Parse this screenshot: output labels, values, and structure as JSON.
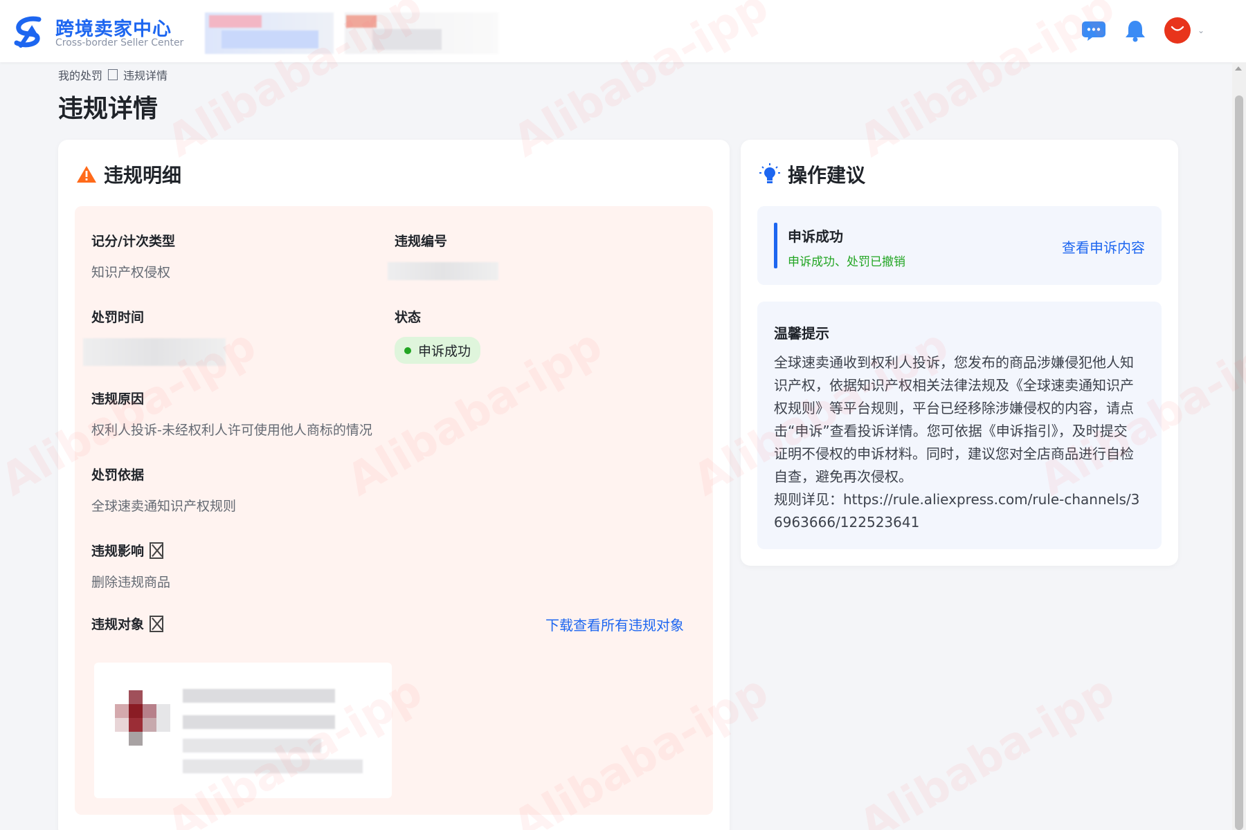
{
  "header": {
    "logo_title": "跨境卖家中心",
    "logo_subtitle": "Cross-border Seller Center",
    "icons": [
      "chat-icon",
      "bell-icon",
      "avatar"
    ],
    "avatar_text": "AliExpress"
  },
  "breadcrumb": {
    "parent": "我的处罚",
    "current": "违规详情"
  },
  "page_title": "违规详情",
  "violation_card": {
    "title": "违规明细",
    "fields": {
      "type_label": "记分/计次类型",
      "type_value": "知识产权侵权",
      "id_label": "违规编号",
      "time_label": "处罚时间",
      "status_label": "状态",
      "status_value": "申诉成功",
      "reason_label": "违规原因",
      "reason_value": "权利人投诉-未经权利人许可使用他人商标的情况",
      "basis_label": "处罚依据",
      "basis_value": "全球速卖通知识产权规则",
      "impact_label": "违规影响",
      "impact_value": "删除违规商品",
      "object_label": "违规对象",
      "download_link": "下载查看所有违规对象"
    }
  },
  "suggestion_card": {
    "title": "操作建议",
    "appeal": {
      "title": "申诉成功",
      "subtitle": "申诉成功、处罚已撤销",
      "link": "查看申诉内容"
    },
    "tips": {
      "title": "温馨提示",
      "body": "全球速卖通收到权利人投诉，您发布的商品涉嫌侵犯他人知识产权，依据知识产权相关法律法规及《全球速卖通知识产权规则》等平台规则，平台已经移除涉嫌侵权的内容，请点击“申诉”查看投诉详情。您可依据《申诉指引》，及时提交证明不侵权的申诉材料。同时，建议您对全店商品进行自检自查，避免再次侵权。",
      "rule_prefix": "规则详见：",
      "rule_url": "https://rule.aliexpress.com/rule-channels/36963666/122523641"
    }
  },
  "watermark_text": "Alibaba-ipp",
  "colors": {
    "accent": "#1d66f0",
    "success": "#22a523",
    "warning": "#ff6a1a",
    "panel_pink": "#fff3f0",
    "panel_blue": "#f3f6fd"
  }
}
